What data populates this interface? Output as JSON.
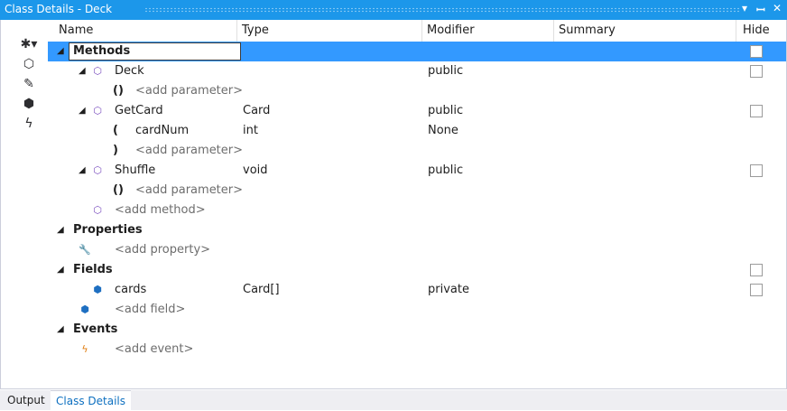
{
  "window": {
    "title": "Class Details - Deck",
    "dropdown_glyph": "▾",
    "pin_glyph": "ꟷ",
    "close_glyph": "✕"
  },
  "toolstrip": {
    "buttons": [
      {
        "name": "new-member-icon",
        "glyph": "✱▾"
      },
      {
        "name": "new-method-icon",
        "glyph": "⬡"
      },
      {
        "name": "new-property-icon",
        "glyph": "✎"
      },
      {
        "name": "new-field-icon",
        "glyph": "⬢"
      },
      {
        "name": "new-event-icon",
        "glyph": "ϟ"
      }
    ]
  },
  "grid": {
    "columns": {
      "name": "Name",
      "type": "Type",
      "modifier": "Modifier",
      "summary": "Summary",
      "hide": "Hide"
    },
    "rows": [
      {
        "kind": "group",
        "label": "Methods",
        "selected": true,
        "hide_checkbox": true
      },
      {
        "kind": "member",
        "icon": "method-icon",
        "glyph": "⬡",
        "label": "Deck",
        "type": "",
        "modifier": "public",
        "hide_checkbox": true
      },
      {
        "kind": "param",
        "paren": "()",
        "label": "<add parameter>",
        "placeholder": true
      },
      {
        "kind": "member",
        "icon": "method-icon",
        "glyph": "⬡",
        "label": "GetCard",
        "type": "Card",
        "modifier": "public",
        "hide_checkbox": true
      },
      {
        "kind": "param",
        "paren": "(",
        "label": "cardNum",
        "type": "int",
        "modifier": "None"
      },
      {
        "kind": "param",
        "paren": ")",
        "label": "<add parameter>",
        "placeholder": true
      },
      {
        "kind": "member",
        "icon": "method-icon",
        "glyph": "⬡",
        "label": "Shuffle",
        "type": "void",
        "modifier": "public",
        "hide_checkbox": true
      },
      {
        "kind": "param",
        "paren": "()",
        "label": "<add parameter>",
        "placeholder": true
      },
      {
        "kind": "add",
        "icon": "method-icon",
        "glyph": "⬡",
        "label": "<add method>"
      },
      {
        "kind": "group",
        "label": "Properties"
      },
      {
        "kind": "add",
        "icon": "wrench-icon",
        "glyph": "🔧",
        "label": "<add property>"
      },
      {
        "kind": "group",
        "label": "Fields",
        "hide_checkbox": true
      },
      {
        "kind": "member",
        "icon": "field-icon",
        "glyph": "⬢",
        "label": "cards",
        "type": "Card[]",
        "modifier": "private",
        "hide_checkbox": true,
        "no_expander": true
      },
      {
        "kind": "add",
        "icon": "field-icon",
        "glyph": "⬢",
        "label": "<add field>"
      },
      {
        "kind": "group",
        "label": "Events"
      },
      {
        "kind": "add",
        "icon": "event-icon",
        "glyph": "ϟ",
        "label": "<add event>"
      }
    ]
  },
  "bottom_tabs": [
    {
      "label": "Output",
      "active": false
    },
    {
      "label": "Class Details",
      "active": true
    }
  ],
  "colors": {
    "accent": "#1c97ea",
    "selection": "#3399ff",
    "method_icon": "#7b4fbf",
    "field_icon": "#1e6fc1",
    "event_icon": "#e07d10",
    "placeholder_text": "#6d6d6d"
  }
}
